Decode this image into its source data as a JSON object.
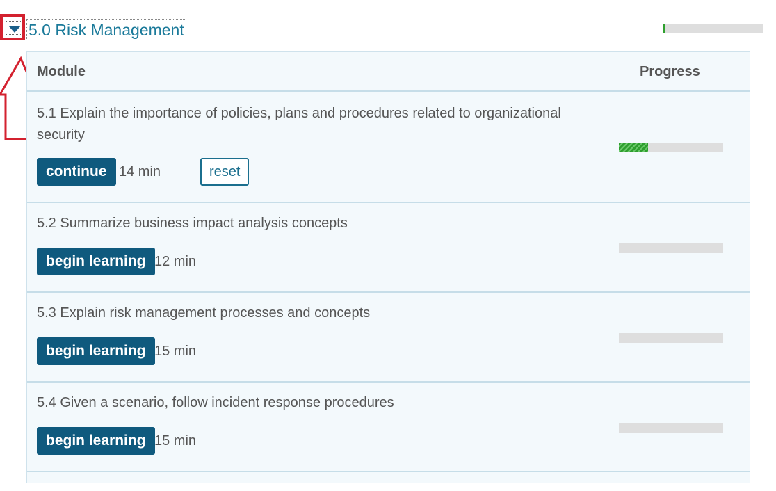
{
  "section": {
    "title": "5.0 Risk Management",
    "progress_fraction": 0.02,
    "toggle_icon": "caret-down-icon",
    "accent_color": "#1b7a9a"
  },
  "table": {
    "headers": {
      "module": "Module",
      "progress": "Progress"
    },
    "rows": [
      {
        "title": "5.1 Explain the importance of policies, plans and procedures related to organizational security",
        "action_label": "continue",
        "duration": "14 min",
        "reset_label": "reset",
        "progress_fraction": 0.28
      },
      {
        "title": "5.2 Summarize business impact analysis concepts",
        "action_label": "begin learning",
        "duration": "12 min",
        "progress_fraction": 0
      },
      {
        "title": "5.3 Explain risk management processes and concepts",
        "action_label": "begin learning",
        "duration": "15 min",
        "progress_fraction": 0
      },
      {
        "title": "5.4 Given a scenario, follow incident response procedures",
        "action_label": "begin learning",
        "duration": "15 min",
        "progress_fraction": 0
      }
    ]
  },
  "colors": {
    "button_bg": "#0f5a7e",
    "progress_green": "#2e9e2e",
    "highlight_red": "#d3212f"
  }
}
